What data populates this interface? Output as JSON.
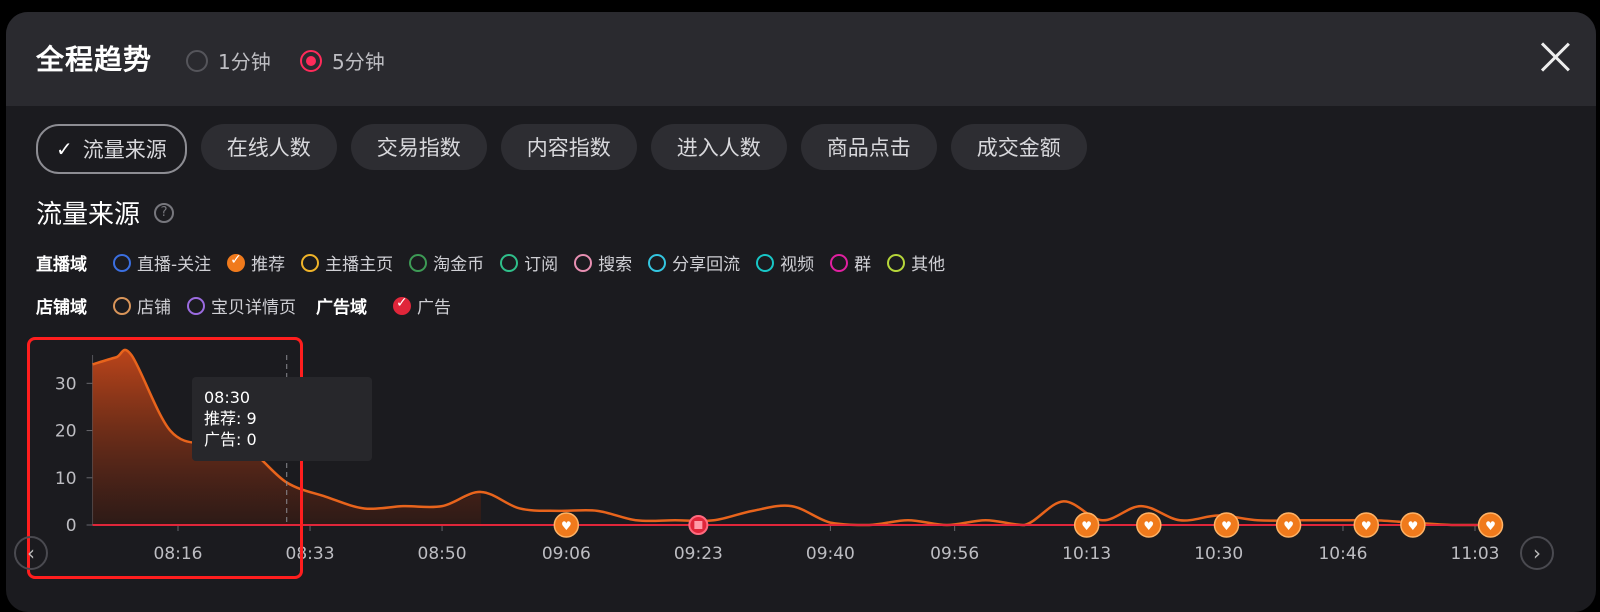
{
  "header": {
    "title": "全程趋势",
    "radio_options": [
      {
        "label": "1分钟",
        "selected": false
      },
      {
        "label": "5分钟",
        "selected": true
      }
    ]
  },
  "tabs": [
    {
      "label": "流量来源",
      "active": true
    },
    {
      "label": "在线人数",
      "active": false
    },
    {
      "label": "交易指数",
      "active": false
    },
    {
      "label": "内容指数",
      "active": false
    },
    {
      "label": "进入人数",
      "active": false
    },
    {
      "label": "商品点击",
      "active": false
    },
    {
      "label": "成交金额",
      "active": false
    }
  ],
  "section": {
    "title": "流量来源",
    "help_icon": "?"
  },
  "legend": {
    "row1_group": "直播域",
    "row1": [
      {
        "label": "直播-关注",
        "color": "#3b6fe0",
        "checked": false
      },
      {
        "label": "推荐",
        "color": "#f07a1c",
        "checked": true
      },
      {
        "label": "主播主页",
        "color": "#f0b429",
        "checked": false
      },
      {
        "label": "淘金币",
        "color": "#3d9a55",
        "checked": false
      },
      {
        "label": "订阅",
        "color": "#2fbf8a",
        "checked": false
      },
      {
        "label": "搜索",
        "color": "#e88fb2",
        "checked": false
      },
      {
        "label": "分享回流",
        "color": "#34c6e0",
        "checked": false
      },
      {
        "label": "视频",
        "color": "#18c7c7",
        "checked": false
      },
      {
        "label": "群",
        "color": "#e020a0",
        "checked": false
      },
      {
        "label": "其他",
        "color": "#b6d63a",
        "checked": false
      }
    ],
    "row2_group": "店铺域",
    "row2": [
      {
        "label": "店铺",
        "color": "#d9955a",
        "checked": false
      },
      {
        "label": "宝贝详情页",
        "color": "#9b6be0",
        "checked": false
      }
    ],
    "row2_group_b": "广告域",
    "row2b": [
      {
        "label": "广告",
        "color": "#e0263a",
        "checked": true
      }
    ]
  },
  "tooltip": {
    "time": "08:30",
    "line1": "推荐: 9",
    "line2": "广告: 0"
  },
  "colors": {
    "series_recommend": "#e8641c",
    "series_ad": "#e0263a",
    "marker": "#f07a1c",
    "highlight": "#ff1e1e"
  },
  "chart_data": {
    "type": "area",
    "x_ticks": [
      "08:16",
      "08:33",
      "08:50",
      "09:06",
      "09:23",
      "09:40",
      "09:56",
      "10:13",
      "10:30",
      "10:46",
      "11:03"
    ],
    "y_ticks": [
      0,
      10,
      20,
      30
    ],
    "ylim": [
      0,
      36
    ],
    "grid": false,
    "series": [
      {
        "name": "推荐",
        "x": [
          "08:05",
          "08:08",
          "08:10",
          "08:15",
          "08:20",
          "08:25",
          "08:30",
          "08:35",
          "08:40",
          "08:45",
          "08:50",
          "08:55",
          "09:00",
          "09:05",
          "09:10",
          "09:15",
          "09:20",
          "09:25",
          "09:30",
          "09:35",
          "09:40",
          "09:45",
          "09:50",
          "09:55",
          "10:00",
          "10:05",
          "10:10",
          "10:15",
          "10:20",
          "10:25",
          "10:30",
          "10:35",
          "10:40",
          "10:45",
          "10:50",
          "10:55",
          "11:00",
          "11:05"
        ],
        "values": [
          34,
          35.5,
          36,
          20,
          17,
          16,
          9,
          6,
          3.5,
          4,
          4,
          7,
          3.5,
          3,
          3,
          1,
          1,
          1,
          3,
          4,
          0.5,
          0,
          1,
          0,
          1,
          0,
          5,
          1,
          4,
          1,
          2,
          1,
          1,
          1,
          1,
          0.5,
          0,
          0
        ]
      },
      {
        "name": "广告",
        "x": [
          "08:05",
          "11:05"
        ],
        "values": [
          0,
          0
        ]
      }
    ],
    "markers_at": [
      "09:06",
      "09:23",
      "10:13",
      "10:21",
      "10:31",
      "10:39",
      "10:49",
      "10:55",
      "11:05"
    ],
    "crosshair_at": "08:30"
  }
}
